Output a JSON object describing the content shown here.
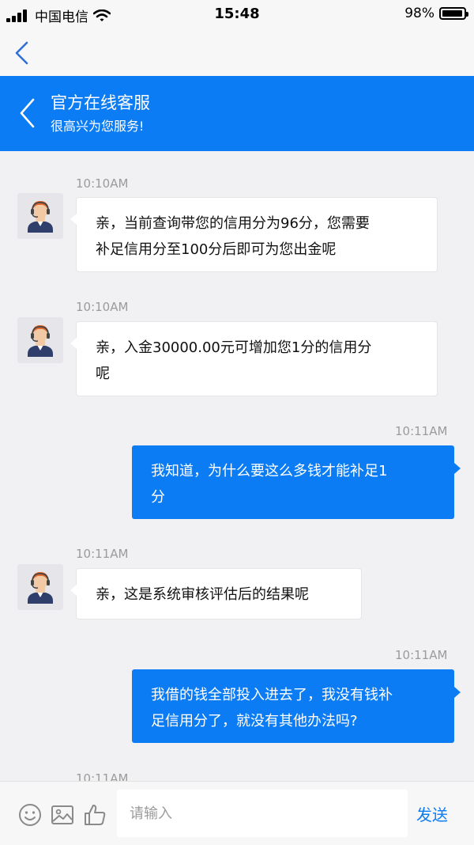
{
  "status_bar": {
    "carrier": "中国电信",
    "time": "15:48",
    "battery": "98%",
    "battery_level": 0.98
  },
  "header": {
    "title": "官方在线客服",
    "subtitle": "很高兴为您服务!"
  },
  "messages": [
    {
      "from": "agent",
      "time": "10:10AM",
      "lines": [
        "亲，当前查询带您的信用分为96分，您需要",
        "补足信用分至100分后即可为您出金呢"
      ]
    },
    {
      "from": "agent",
      "time": "10:10AM",
      "lines": [
        "亲，入金30000.00元可增加您1分的信用分",
        "呢"
      ]
    },
    {
      "from": "user",
      "time": "10:11AM",
      "lines": [
        "我知道，为什么要这么多钱才能补足1",
        "分"
      ]
    },
    {
      "from": "agent",
      "time": "10:11AM",
      "lines": [
        "亲，这是系统审核评估后的结果呢"
      ]
    },
    {
      "from": "user",
      "time": "10:11AM",
      "lines": [
        "我借的钱全部投入进去了，我没有钱补",
        "足信用分了，就没有其他办法吗?"
      ]
    },
    {
      "from": "agent",
      "time": "10:11AM",
      "lines": []
    }
  ],
  "input": {
    "placeholder": "请输入",
    "value": ""
  },
  "send_label": "发送",
  "icons": [
    "signal-icon",
    "wifi-icon",
    "battery-icon",
    "back-icon",
    "emoji-icon",
    "image-icon",
    "like-icon"
  ],
  "colors": {
    "accent": "#0b7cf3",
    "background": "#f1f1f3"
  }
}
